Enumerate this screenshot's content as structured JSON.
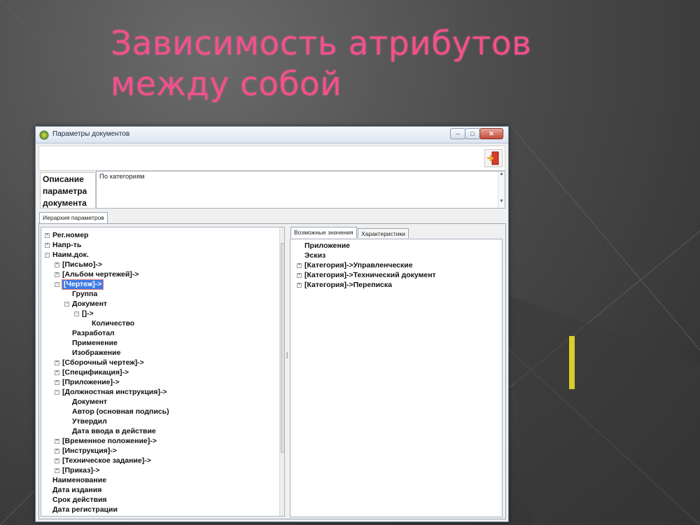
{
  "slide": {
    "title_line1": "Зависимость атрибутов",
    "title_line2": "между собой"
  },
  "window": {
    "title": "Параметры документов",
    "minimize_label": "–",
    "maximize_label": "□",
    "close_label": "✕"
  },
  "description": {
    "label": "Описание параметра документа",
    "value": "По категориям"
  },
  "tabs": {
    "hierarchy": "Иерархия параметров",
    "possible_values": "Возможные значения",
    "characteristics": "Характеристики"
  },
  "left_tree": [
    {
      "label": "Рег.номер",
      "level": 0,
      "exp": "+"
    },
    {
      "label": "Напр-ть",
      "level": 0,
      "exp": "+"
    },
    {
      "label": "Наим.док.",
      "level": 0,
      "exp": "-"
    },
    {
      "label": "[Письмо]->",
      "level": 1,
      "exp": "+"
    },
    {
      "label": "[Альбом чертежей]->",
      "level": 1,
      "exp": "+"
    },
    {
      "label": "[Чертеж]->",
      "level": 1,
      "exp": "-",
      "selected": true
    },
    {
      "label": "Группа",
      "level": 2,
      "exp": ""
    },
    {
      "label": "Документ",
      "level": 2,
      "exp": "-"
    },
    {
      "label": "[]->",
      "level": 3,
      "exp": "-"
    },
    {
      "label": "Количество",
      "level": 4,
      "exp": ""
    },
    {
      "label": "Разработал",
      "level": 2,
      "exp": ""
    },
    {
      "label": "Применение",
      "level": 2,
      "exp": ""
    },
    {
      "label": "Изображение",
      "level": 2,
      "exp": ""
    },
    {
      "label": "[Сборочный чертеж]->",
      "level": 1,
      "exp": "+"
    },
    {
      "label": "[Спецификация]->",
      "level": 1,
      "exp": "+"
    },
    {
      "label": "[Приложение]->",
      "level": 1,
      "exp": "+"
    },
    {
      "label": "[Должностная инструкция]->",
      "level": 1,
      "exp": "-"
    },
    {
      "label": "Документ",
      "level": 2,
      "exp": ""
    },
    {
      "label": "Автор (основная подпись)",
      "level": 2,
      "exp": ""
    },
    {
      "label": "Утвердил",
      "level": 2,
      "exp": ""
    },
    {
      "label": "Дата ввода в действие",
      "level": 2,
      "exp": ""
    },
    {
      "label": "[Временное положение]->",
      "level": 1,
      "exp": "+"
    },
    {
      "label": "[Инструкция]->",
      "level": 1,
      "exp": "+"
    },
    {
      "label": "[Техническое задание]->",
      "level": 1,
      "exp": "+"
    },
    {
      "label": "[Приказ]->",
      "level": 1,
      "exp": "+"
    },
    {
      "label": "Наименование",
      "level": 0,
      "exp": ""
    },
    {
      "label": "Дата издания",
      "level": 0,
      "exp": ""
    },
    {
      "label": "Срок действия",
      "level": 0,
      "exp": ""
    },
    {
      "label": "Дата регистрации",
      "level": 0,
      "exp": ""
    }
  ],
  "right_tree": [
    {
      "label": "Приложение",
      "exp": ""
    },
    {
      "label": "Эскиз",
      "exp": ""
    },
    {
      "label": "[Категория]->Управленческие",
      "exp": "+"
    },
    {
      "label": "[Категория]->Технический документ",
      "exp": "+"
    },
    {
      "label": "[Категория]->Переписка",
      "exp": "+"
    }
  ],
  "colors": {
    "title": "#f4508c",
    "accent_bar": "#d8cf2a",
    "selection": "#3b7be6"
  }
}
